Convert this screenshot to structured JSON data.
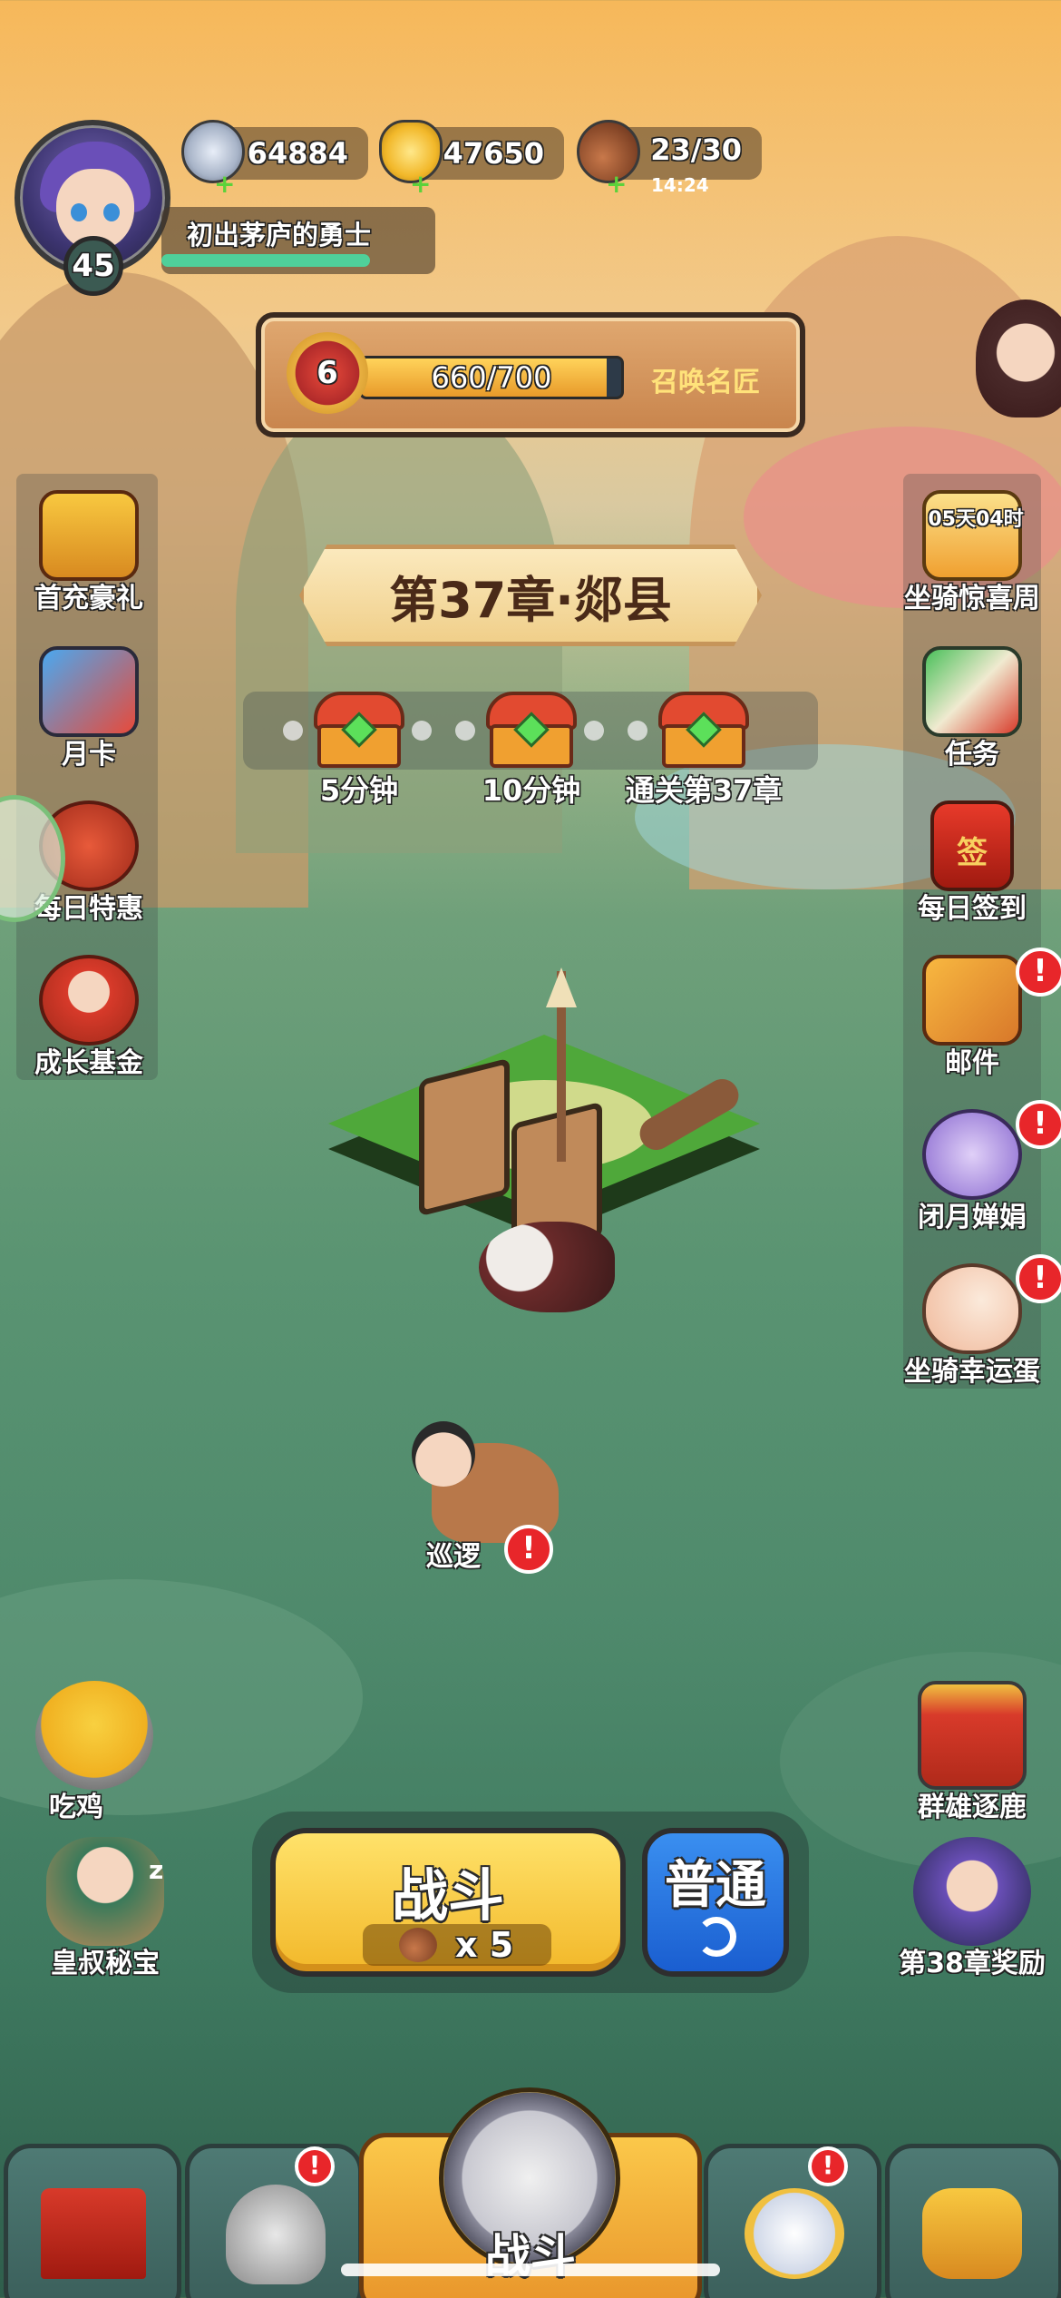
{
  "resources": {
    "silver": "64884",
    "gold": "47650",
    "stamina": "23/30",
    "stamina_timer": "14:24"
  },
  "player": {
    "level": "45",
    "title": "初出茅庐的勇士",
    "exp_fraction": 0.8
  },
  "smith": {
    "level": "6",
    "progress_text": "660/700",
    "progress_fraction": 0.943,
    "label": "召唤名匠"
  },
  "left_features": [
    {
      "label": "首充豪礼",
      "icon": "gift-chest-icon"
    },
    {
      "label": "月卡",
      "icon": "calendar-card-icon"
    },
    {
      "label": "每日特惠",
      "icon": "money-bag-icon"
    },
    {
      "label": "成长基金",
      "icon": "fortune-god-icon"
    }
  ],
  "right_features": [
    {
      "label": "坐骑惊喜周",
      "timer": "05天04时",
      "icon": "mount-surprise-icon",
      "alert": false
    },
    {
      "label": "任务",
      "icon": "scroll-icon",
      "alert": false
    },
    {
      "label": "每日签到",
      "icon": "sign-in-icon",
      "badge_text": "签",
      "alert": false
    },
    {
      "label": "邮件",
      "icon": "mail-icon",
      "alert": true
    },
    {
      "label": "闭月婵娟",
      "icon": "moon-fox-icon",
      "alert": true
    },
    {
      "label": "坐骑幸运蛋",
      "icon": "lucky-egg-icon",
      "alert": true
    }
  ],
  "chapter": {
    "title": "第37章·郯县"
  },
  "rewards": [
    {
      "label": "5分钟"
    },
    {
      "label": "10分钟"
    },
    {
      "label": "通关第37章"
    }
  ],
  "patrol": {
    "label": "巡逻"
  },
  "lower_left": [
    {
      "label": "吃鸡"
    },
    {
      "label": "皇叔秘宝",
      "sleep": "z"
    }
  ],
  "lower_right": [
    {
      "label": "群雄逐鹿"
    },
    {
      "label": "第38章奖励"
    }
  ],
  "battle": {
    "fight_label": "战斗",
    "cost": "x 5",
    "mode_label": "普通"
  },
  "nav": {
    "center_label": "战斗"
  },
  "alert_glyph": "!",
  "colors": {
    "alert": "#e8262a",
    "fight_button": "#f2b82a",
    "mode_button": "#1a5ed0"
  }
}
